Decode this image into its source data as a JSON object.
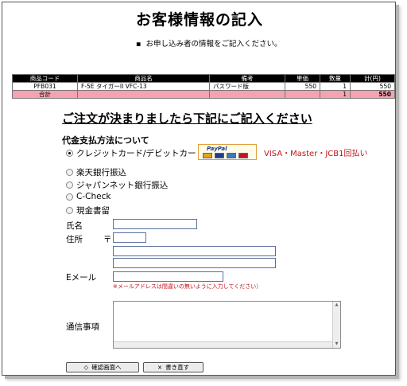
{
  "title": "お客様情報の記入",
  "note": "お申し込み者の情報をご記入ください。",
  "note_bullet": "▪",
  "table": {
    "headers": [
      "商品コード",
      "商品名",
      "備考",
      "単価",
      "数量",
      "計(円)"
    ],
    "rows": [
      [
        "PFB031",
        "F-5E タイガーII VFC-13",
        "パスワード版",
        "550",
        "1",
        "550"
      ]
    ],
    "total": {
      "label": "合計",
      "qty": "1",
      "amount": "550"
    }
  },
  "heading": "ご注文が決まりましたら下記にご記入ください",
  "payment": {
    "title": "代金支払方法について",
    "options": [
      {
        "label": "クレジットカード/デビットカード",
        "selected": true
      },
      {
        "label": "楽天銀行振込",
        "selected": false
      },
      {
        "label": "ジャパンネット銀行振込",
        "selected": false
      },
      {
        "label": "C-Check",
        "selected": false
      },
      {
        "label": "現金書留",
        "selected": false
      }
    ],
    "paypal_logo_text": "PayPal",
    "cards_text": "VISA・Master・JCB1回払い"
  },
  "form": {
    "name_label": "氏名",
    "address_label": "住所",
    "postal_mark": "〒",
    "email_label": "Eメール",
    "email_warning": "※メールアドレスは間違いの無いように入力してください）",
    "message_label": "通信事項"
  },
  "buttons": {
    "confirm": {
      "icon": "◇",
      "label": "確認画面へ"
    },
    "reset": {
      "icon": "×",
      "label": "書き直す"
    }
  }
}
